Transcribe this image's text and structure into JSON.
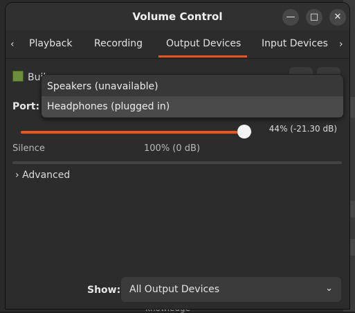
{
  "background": {
    "bottom_text": "knowledge"
  },
  "window": {
    "title": "Volume Control",
    "controls": {
      "minimize_icon": "minimize-icon",
      "maximize_icon": "maximize-icon",
      "close_icon": "close-icon"
    }
  },
  "tabs": {
    "items": [
      {
        "label": "Playback"
      },
      {
        "label": "Recording"
      },
      {
        "label": "Output Devices",
        "active": true
      },
      {
        "label": "Input Devices"
      }
    ],
    "scroll_left_icon": "chevron-left-icon",
    "scroll_right_icon": "chevron-right-icon"
  },
  "device": {
    "name": "Buil",
    "icon": "sound-card-icon",
    "port_label": "Port:",
    "volume_percent": 44,
    "volume_readout": "44% (-21.30 dB)",
    "silence_label": "Silence",
    "hundred_label": "100% (0 dB)"
  },
  "advanced": {
    "label": "Advanced",
    "icon": "chevron-right-icon"
  },
  "port_popup": {
    "options": [
      {
        "label": "Speakers (unavailable)"
      },
      {
        "label": "Headphones (plugged in)",
        "selected": true
      }
    ]
  },
  "show_filter": {
    "label": "Show:",
    "value": "All Output Devices",
    "icon": "chevron-down-icon"
  },
  "colors": {
    "accent": "#e95420",
    "window_bg": "#2c2c2c",
    "text": "#dcdcdc"
  }
}
